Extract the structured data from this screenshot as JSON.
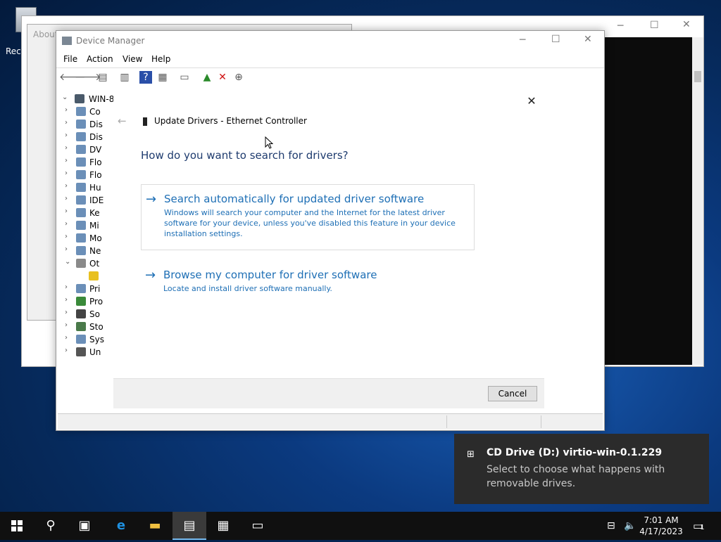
{
  "desktop": {
    "recycle_bin_label": "Rec"
  },
  "about_window": {
    "title": "About"
  },
  "device_manager": {
    "title": "Device Manager",
    "menu": [
      "File",
      "Action",
      "View",
      "Help"
    ],
    "tree_root": "WIN-8",
    "tree_items": [
      "Co",
      "Dis",
      "Dis",
      "DV",
      "Flo",
      "Flo",
      "Hu",
      "IDE",
      "Ke",
      "Mi",
      "Mo",
      "Ne",
      "Ot",
      "",
      "Pri",
      "Pro",
      "So",
      "Sto",
      "Sys",
      "Un"
    ]
  },
  "dialog": {
    "title": "Update Drivers - Ethernet Controller",
    "question": "How do you want to search for drivers?",
    "option1_title": "Search automatically for updated driver software",
    "option1_desc": "Windows will search your computer and the Internet for the latest driver software for your device, unless you've disabled this feature in your device installation settings.",
    "option2_title": "Browse my computer for driver software",
    "option2_desc": "Locate and install driver software manually.",
    "cancel": "Cancel"
  },
  "toast": {
    "title": "CD Drive (D:) virtio-win-0.1.229",
    "body": "Select to choose what happens with removable drives."
  },
  "taskbar": {
    "time": "7:01 AM",
    "date": "4/17/2023",
    "notification_count": "1"
  }
}
